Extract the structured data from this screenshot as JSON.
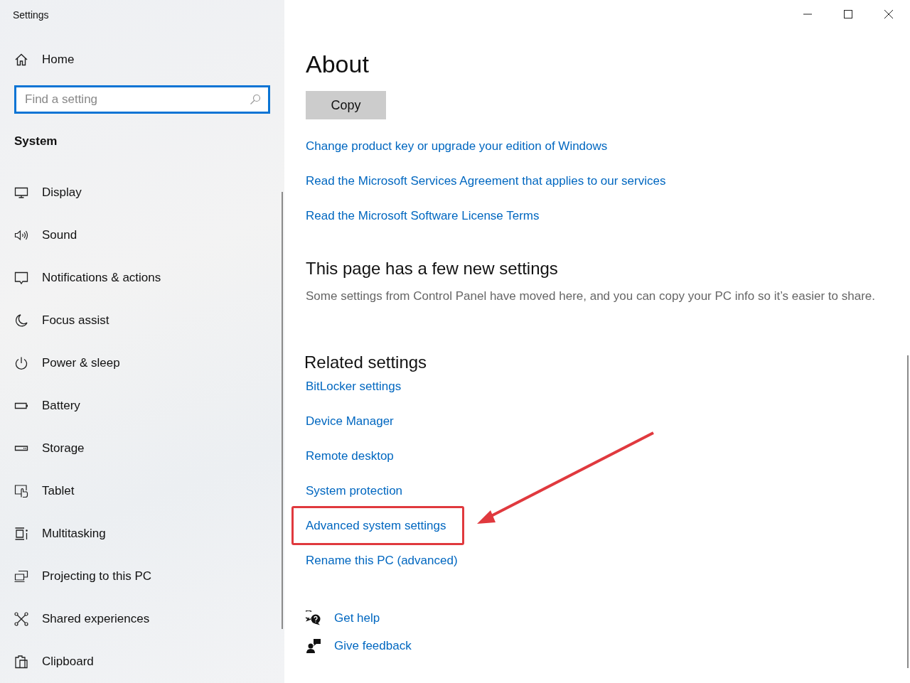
{
  "window": {
    "title": "Settings"
  },
  "sidebar": {
    "home": "Home",
    "search": {
      "placeholder": "Find a setting"
    },
    "section": "System",
    "items": [
      {
        "label": "Display",
        "selected": false
      },
      {
        "label": "Sound",
        "selected": false
      },
      {
        "label": "Notifications & actions",
        "selected": false
      },
      {
        "label": "Focus assist",
        "selected": false
      },
      {
        "label": "Power & sleep",
        "selected": false
      },
      {
        "label": "Battery",
        "selected": false
      },
      {
        "label": "Storage",
        "selected": false
      },
      {
        "label": "Tablet",
        "selected": false
      },
      {
        "label": "Multitasking",
        "selected": false
      },
      {
        "label": "Projecting to this PC",
        "selected": false
      },
      {
        "label": "Shared experiences",
        "selected": false
      },
      {
        "label": "Clipboard",
        "selected": false
      }
    ]
  },
  "main": {
    "title": "About",
    "copy_button": "Copy",
    "links": [
      "Change product key or upgrade your edition of Windows",
      "Read the Microsoft Services Agreement that applies to our services",
      "Read the Microsoft Software License Terms"
    ],
    "new_settings": {
      "heading": "This page has a few new settings",
      "text": "Some settings from Control Panel have moved here, and you can copy your PC info so it’s easier to share."
    },
    "related": {
      "heading": "Related settings",
      "links": [
        {
          "label": "BitLocker settings",
          "annotated": false
        },
        {
          "label": "Device Manager",
          "annotated": false
        },
        {
          "label": "Remote desktop",
          "annotated": false
        },
        {
          "label": "System protection",
          "annotated": false
        },
        {
          "label": "Advanced system settings",
          "annotated": true
        },
        {
          "label": "Rename this PC (advanced)",
          "annotated": false
        }
      ]
    },
    "help": [
      "Get help",
      "Give feedback"
    ]
  }
}
